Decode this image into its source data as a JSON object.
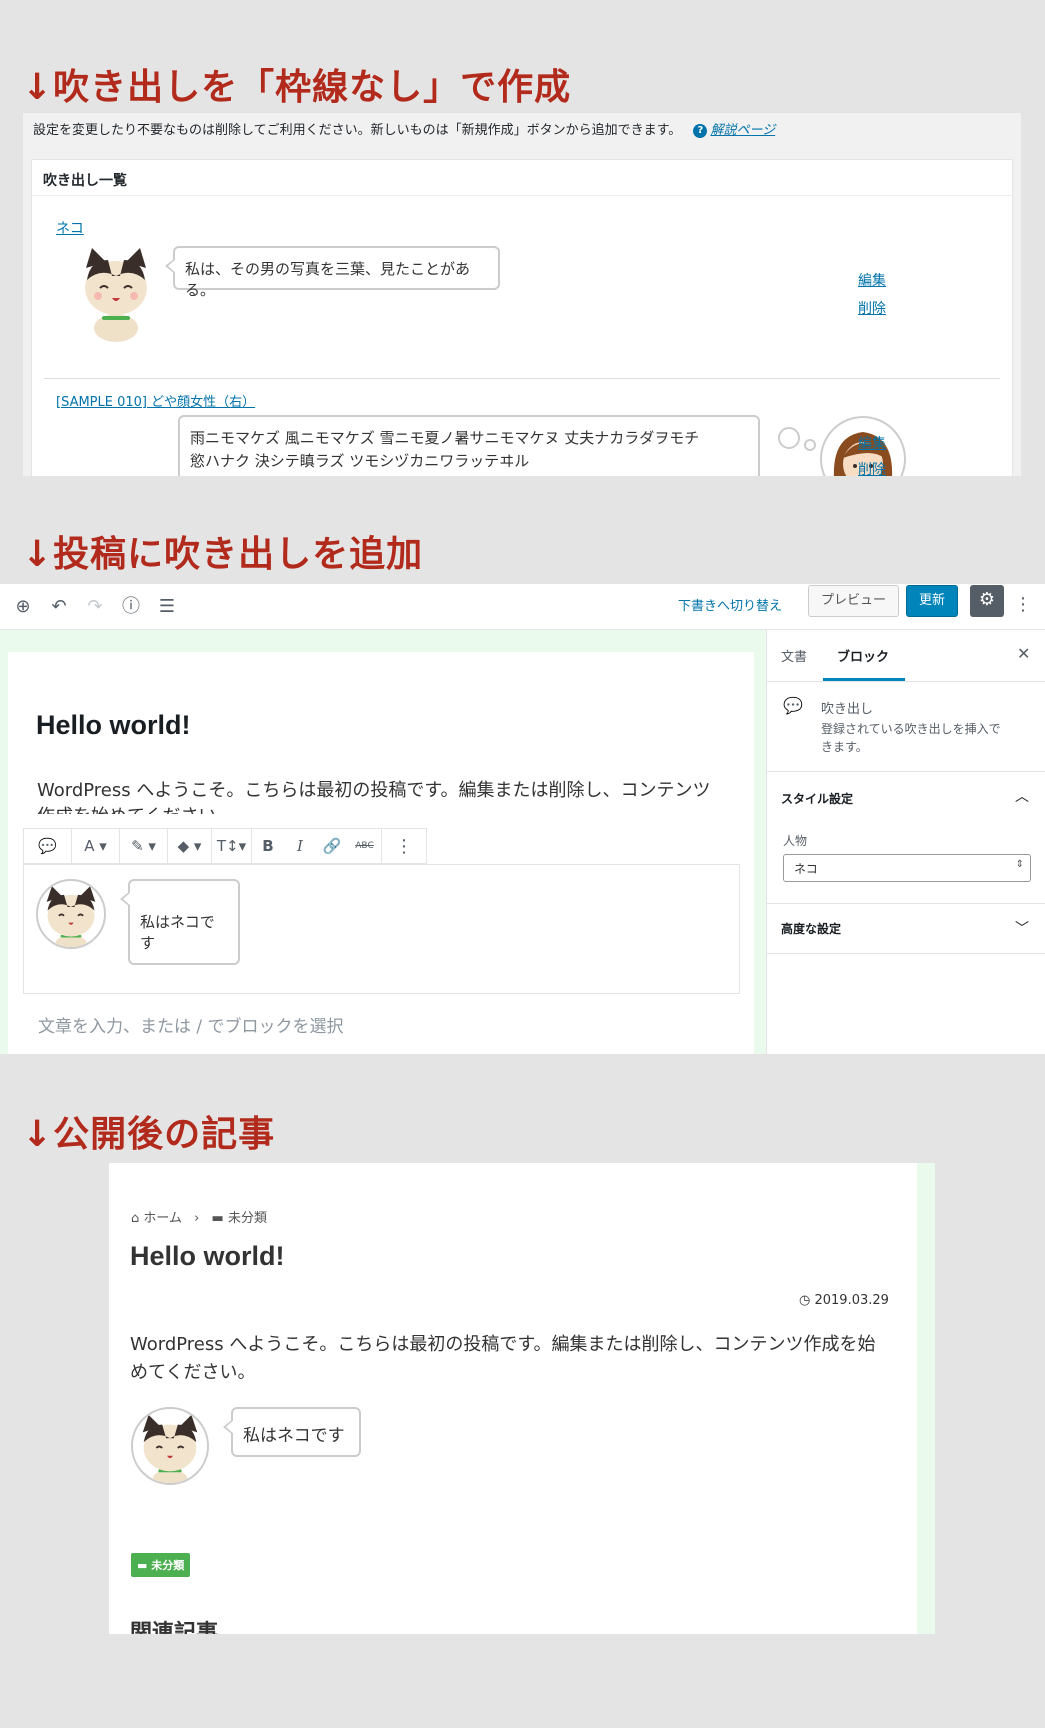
{
  "sections": {
    "s1_heading": "↓吹き出しを「枠線なし」で作成",
    "s2_heading": "↓投稿に吹き出しを追加",
    "s3_heading": "↓公開後の記事"
  },
  "admin": {
    "note": "設定を変更したり不要なものは削除してご利用ください。新しいものは「新規作成」ボタンから追加できます。",
    "help_link": "解説ページ",
    "list_title": "吹き出し一覧",
    "items": [
      {
        "name": "ネコ",
        "text": "私は、その男の写真を三葉、見たことがある。",
        "edit": "編集",
        "delete": "削除"
      },
      {
        "name": "[SAMPLE 010] どや顔女性（右）",
        "text_line1": "雨ニモマケズ 風ニモマケズ 雪ニモ夏ノ暑サニモマケヌ 丈夫ナカラダヲモチ",
        "text_line2": "慾ハナク 決シテ瞋ラズ ツモシヅカニワラッテヰル",
        "edit": "編集",
        "delete": "削除"
      }
    ]
  },
  "editor": {
    "switch_draft": "下書きへ切り替え",
    "preview": "プレビュー",
    "update": "更新",
    "post_title": "Hello world!",
    "paragraph": "WordPress へようこそ。こちらは最初の投稿です。編集または削除し、コンテンツ",
    "paragraph_cut": "作成を始めてください。",
    "bubble_text": "私はネコです",
    "placeholder": "文章を入力、または / でブロックを選択",
    "sidebar": {
      "tab_document": "文書",
      "tab_block": "ブロック",
      "block_name": "吹き出し",
      "block_desc_line1": "登録されている吹き出しを挿入で",
      "block_desc_line2": "きます。",
      "style_section": "スタイル設定",
      "person_label": "人物",
      "person_value": "ネコ",
      "advanced_section": "高度な設定"
    }
  },
  "article": {
    "breadcrumb_home": "ホーム",
    "breadcrumb_sep": "›",
    "breadcrumb_category": "未分類",
    "title": "Hello world!",
    "date": "2019.03.29",
    "body_line1": "WordPress へようこそ。こちらは最初の投稿です。編集または削除し、コンテンツ作成を始",
    "body_line2": "めてください。",
    "bubble_text": "私はネコです",
    "category_tag": "未分類",
    "related_heading": "関連記事"
  }
}
